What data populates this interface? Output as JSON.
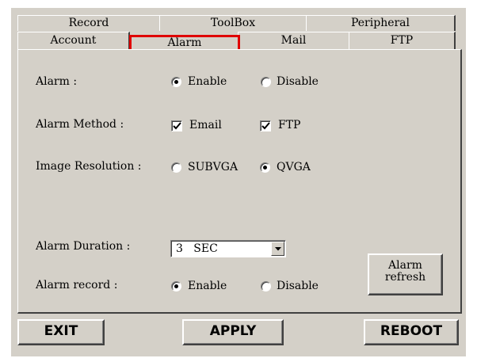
{
  "tabs": {
    "row1": [
      "Record",
      "ToolBox",
      "Peripheral"
    ],
    "row2": [
      "Account",
      "Alarm",
      "Mail",
      "FTP"
    ],
    "active": "Alarm",
    "active_highlight_color": "#e00000"
  },
  "form": {
    "alarm": {
      "label": "Alarm :",
      "options": [
        "Enable",
        "Disable"
      ],
      "selected": "Enable"
    },
    "alarm_method": {
      "label": "Alarm Method :",
      "email_label": "Email",
      "email_checked": true,
      "ftp_label": "FTP",
      "ftp_checked": true
    },
    "image_resolution": {
      "label": "Image Resolution :",
      "options": [
        "SUBVGA",
        "QVGA"
      ],
      "selected": "QVGA"
    },
    "alarm_duration": {
      "label": "Alarm Duration :",
      "value": "3   SEC"
    },
    "alarm_record": {
      "label": "Alarm record :",
      "options": [
        "Enable",
        "Disable"
      ],
      "selected": "Enable"
    }
  },
  "alarm_refresh_button": {
    "line1": "Alarm",
    "line2": "refresh"
  },
  "bottom_buttons": {
    "exit": "EXIT",
    "apply": "APPLY",
    "reboot": "REBOOT"
  },
  "icons": {
    "radio_selected": "radio-dot",
    "checkbox_checked": "checkmark",
    "dropdown": "triangle-down"
  }
}
